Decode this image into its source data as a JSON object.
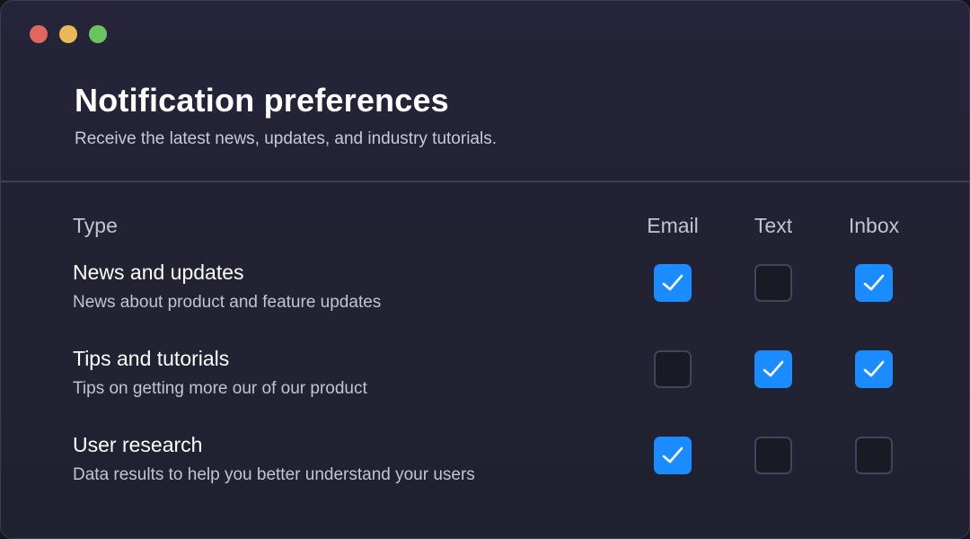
{
  "window": {
    "controls": [
      "close",
      "minimize",
      "maximize"
    ],
    "colors": {
      "close": "#e0665f",
      "minimize": "#e9b958",
      "maximize": "#6bc35d"
    }
  },
  "header": {
    "title": "Notification preferences",
    "subtitle": "Receive the latest news, updates, and industry tutorials."
  },
  "table": {
    "columns": {
      "type": "Type",
      "email": "Email",
      "text": "Text",
      "inbox": "Inbox"
    },
    "rows": [
      {
        "title": "News and updates",
        "description": "News about product and feature updates",
        "email": true,
        "text": false,
        "inbox": true
      },
      {
        "title": "Tips and tutorials",
        "description": "Tips on getting more our of our product",
        "email": false,
        "text": true,
        "inbox": true
      },
      {
        "title": "User research",
        "description": "Data results to help you better understand your users",
        "email": true,
        "text": false,
        "inbox": false
      }
    ]
  },
  "colors": {
    "accent": "#1a8cff",
    "background": "#222233",
    "checkbox_off": "#1a1a25"
  },
  "icons": {
    "checked": "checkmark-icon"
  }
}
